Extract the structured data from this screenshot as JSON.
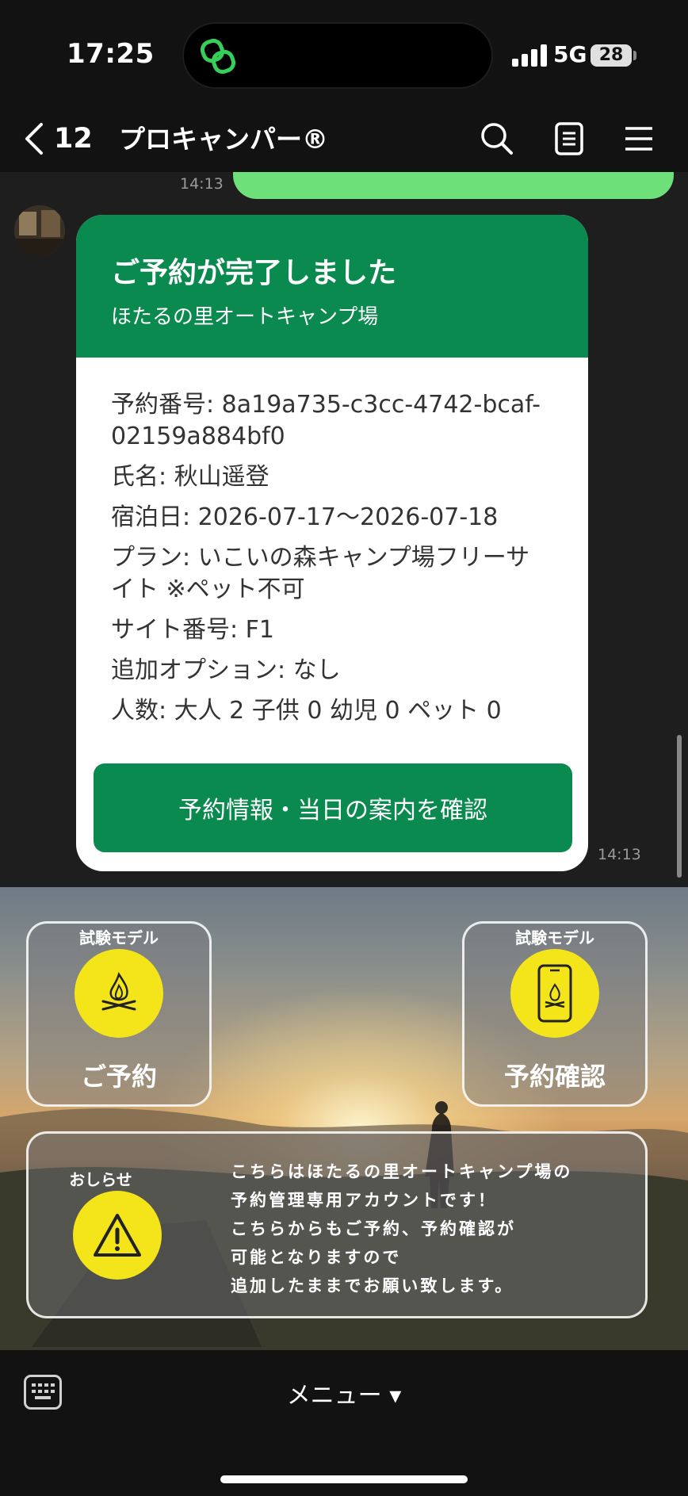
{
  "status_bar": {
    "time": "17:25",
    "network": "5G",
    "battery": "28"
  },
  "header": {
    "back_count": "12",
    "title": "プロキャンパー®"
  },
  "chat": {
    "prev_message_tail": "bcaf-02159a884bf0",
    "prev_time": "14:13",
    "card": {
      "title": "ご予約が完了しました",
      "subtitle": "ほたるの里オートキャンプ場",
      "rows": [
        "予約番号: 8a19a735-c3cc-4742-bcaf-02159a884bf0",
        "氏名: 秋山遥登",
        "宿泊日: 2026-07-17〜2026-07-18",
        "プラン: いこいの森キャンプ場フリーサイト ※ペット不可",
        "サイト番号: F1",
        "追加オプション: なし",
        "人数: 大人 2 子供 0 幼児 0 ペット 0"
      ],
      "button_label": "予約情報・当日の案内を確認"
    },
    "time": "14:13"
  },
  "rich_menu": {
    "reserve": {
      "caption": "試験モデル",
      "label": "ご予約",
      "icon": "campfire-icon"
    },
    "check": {
      "caption": "試験モデル",
      "label": "予約確認",
      "icon": "phone-campfire-icon"
    },
    "notice": {
      "caption": "おしらせ",
      "icon": "warning-icon",
      "lines": [
        "こちらはほたるの里オートキャンプ場の",
        "予約管理専用アカウントです！",
        "こちらからもご予約、予約確認が",
        "可能となりますので",
        "追加したままでお願い致します。"
      ]
    }
  },
  "bottom_bar": {
    "menu_label": "メニュー ▾"
  },
  "colors": {
    "brand_green": "#0b8a4f",
    "bubble_green": "#6ee07a",
    "accent_yellow": "#f4e51b"
  }
}
